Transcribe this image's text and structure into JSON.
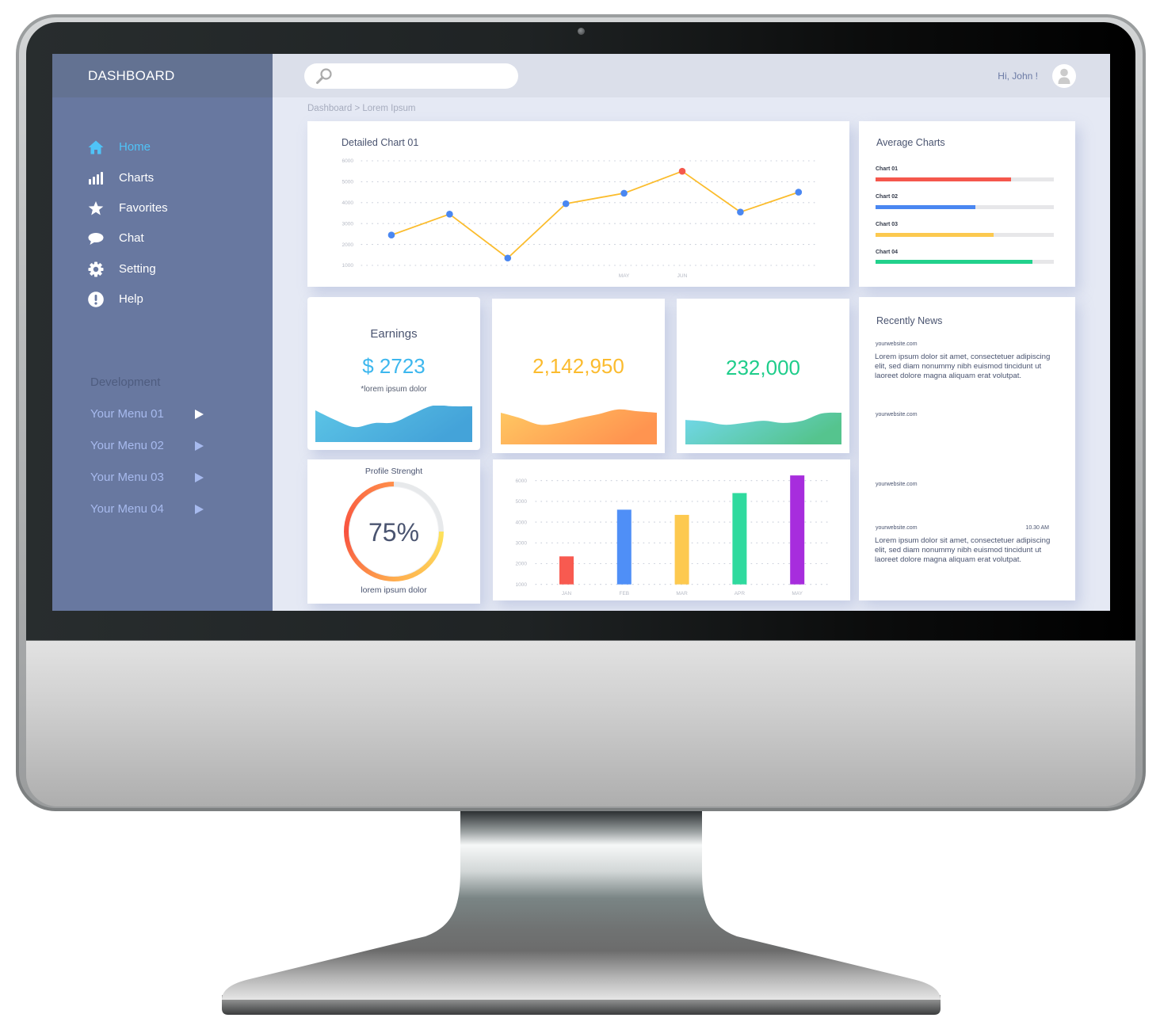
{
  "app": {
    "title": "DASHBOARD"
  },
  "sidebar": {
    "nav": [
      {
        "label": "Home",
        "icon": "home-icon",
        "active": true
      },
      {
        "label": "Charts",
        "icon": "bar-chart-icon",
        "active": false
      },
      {
        "label": "Favorites",
        "icon": "star-icon",
        "active": false
      },
      {
        "label": "Chat",
        "icon": "chat-bubble-icon",
        "active": false
      },
      {
        "label": "Setting",
        "icon": "gear-icon",
        "active": false
      },
      {
        "label": "Help",
        "icon": "exclamation-circle-icon",
        "active": false
      }
    ],
    "section_label": "Development",
    "menus": [
      {
        "label": "Your Menu 01",
        "icon": "play-arrow-icon",
        "highlighted": true
      },
      {
        "label": "Your Menu 02",
        "icon": "play-arrow-icon",
        "highlighted": false
      },
      {
        "label": "Your Menu 03",
        "icon": "play-arrow-icon",
        "highlighted": false
      },
      {
        "label": "Your Menu 04",
        "icon": "play-arrow-icon",
        "highlighted": false
      }
    ],
    "active_color": "#4fc3f7"
  },
  "topbar": {
    "search": {
      "placeholder": "",
      "value": "",
      "icon": "search-icon"
    },
    "greeting": "Hi, John !",
    "avatar_icon": "user-avatar-icon"
  },
  "breadcrumb": {
    "text": "Dashboard > Lorem Ipsum",
    "items": [
      "Dashboard",
      "Lorem Ipsum"
    ],
    "separator": ">"
  },
  "stat_cards": [
    {
      "title": "Earnings",
      "value": "$ 2723",
      "note": "*lorem ipsum dolor",
      "color": "#3db7ee",
      "sparkline": [
        0.87,
        0.61,
        0.41,
        0.52,
        0.54,
        0.78,
        1.0,
        0.98,
        0.98
      ],
      "gradient": [
        "#5cc5e6",
        "#44a3d9"
      ]
    },
    {
      "title": "",
      "value": "2,142,950",
      "note": "",
      "color": "#fbbb2e",
      "sparkline": [
        0.87,
        0.72,
        0.54,
        0.59,
        0.72,
        0.83,
        0.96,
        0.91,
        0.87
      ],
      "gradient": [
        "#ffc862",
        "#ff9450"
      ]
    },
    {
      "title": "",
      "value": "232,000",
      "note": "",
      "color": "#1fcd8b",
      "sparkline": [
        0.67,
        0.63,
        0.54,
        0.59,
        0.65,
        0.59,
        0.65,
        0.85,
        0.87
      ],
      "gradient": [
        "#72d8ec",
        "#55c48e"
      ]
    }
  ],
  "profile": {
    "title": "Profile Strenght",
    "percent": 75,
    "label": "75%",
    "caption": "lorem ipsum dolor",
    "colors": [
      "#fde35c",
      "#ffac4e",
      "#f8513f",
      "#ff8f4b"
    ],
    "track": "#e7e9eb"
  },
  "news": {
    "title": "Recently News",
    "items": [
      {
        "source": "yourwebsite.com",
        "time": "",
        "text": "Lorem ipsum dolor sit amet, consectetuer adipiscing elit, sed diam nonummy nibh euismod tincidunt ut laoreet dolore magna aliquam erat volutpat."
      },
      {
        "source": "yourwebsite.com",
        "time": "",
        "text": ""
      },
      {
        "source": "yourwebsite.com",
        "time": "",
        "text": ""
      },
      {
        "source": "yourwebsite.com",
        "time": "10.30 AM",
        "text": "Lorem ipsum dolor sit amet, consectetuer adipiscing elit, sed diam nonummy nibh euismod tincidunt ut laoreet dolore magna aliquam erat volutpat."
      }
    ]
  },
  "chart_data": [
    {
      "type": "line",
      "title": "Detailed Chart 01",
      "x": [
        "",
        "",
        "",
        "",
        "MAY",
        "JUN",
        "",
        ""
      ],
      "series": [
        {
          "name": "Detailed Chart 01",
          "values": [
            2450,
            3450,
            1350,
            3950,
            4450,
            5500,
            3550,
            4500
          ],
          "line_color": "#fbbc2c",
          "point_color": "#4a87f1",
          "highlight_color": "#f4584c",
          "highlight_index": 5
        }
      ],
      "yticks": [
        1000,
        2000,
        3000,
        4000,
        5000,
        6000
      ],
      "ylim": [
        1000,
        6000
      ],
      "xlabel": "",
      "ylabel": "",
      "grid": true,
      "legend": "none"
    },
    {
      "type": "bar",
      "title": "",
      "categories": [
        "JAN",
        "FEB",
        "MAR",
        "APR",
        "MAY"
      ],
      "values": [
        2350,
        4600,
        4350,
        5400,
        6250
      ],
      "colors": [
        "#f85a50",
        "#4f8ff7",
        "#fdc94f",
        "#2fda9e",
        "#a72ddd"
      ],
      "yticks": [
        1000,
        2000,
        3000,
        4000,
        5000,
        6000
      ],
      "ylim": [
        1000,
        6000
      ],
      "xlabel": "",
      "ylabel": "",
      "grid": true,
      "legend": "none"
    },
    {
      "type": "bar",
      "orientation": "horizontal",
      "title": "Average Charts",
      "categories": [
        "Chart 01",
        "Chart 02",
        "Chart 03",
        "Chart 04"
      ],
      "values": [
        76,
        56,
        66,
        88
      ],
      "colors": [
        "#f5574c",
        "#4a87f1",
        "#fcc94f",
        "#22d18c"
      ],
      "ylim": [
        0,
        100
      ],
      "grid": false,
      "legend": "none"
    }
  ]
}
